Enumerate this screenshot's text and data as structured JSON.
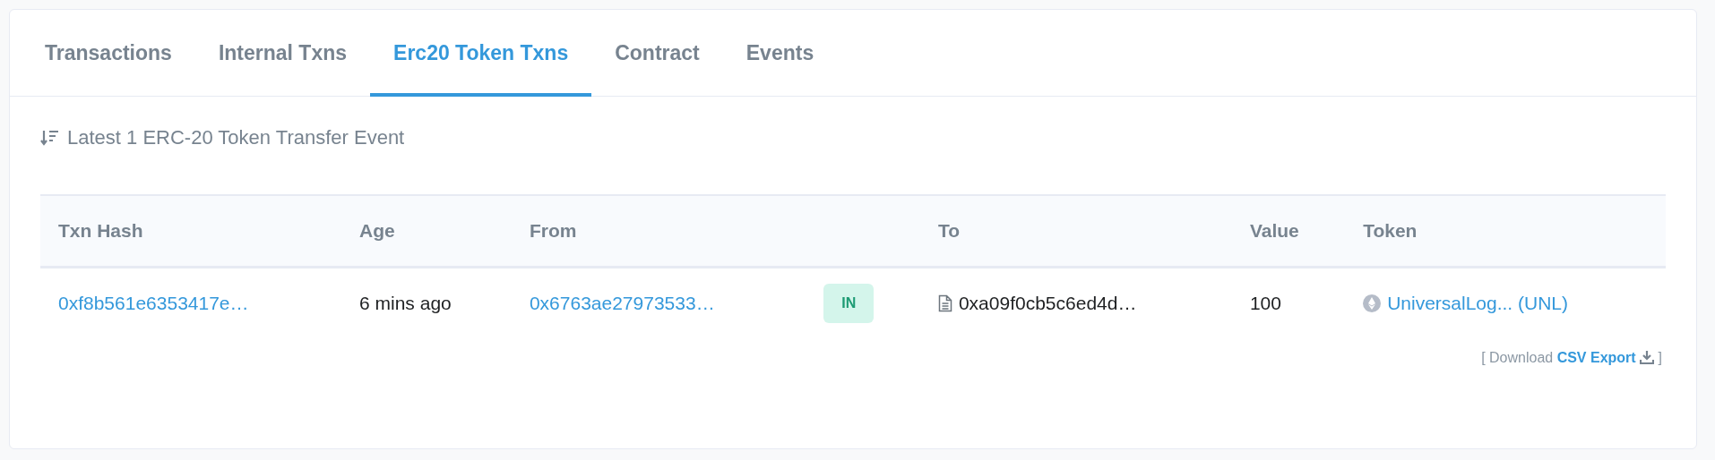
{
  "tabs": [
    {
      "label": "Transactions",
      "selected": false
    },
    {
      "label": "Internal Txns",
      "selected": false
    },
    {
      "label": "Erc20 Token Txns",
      "selected": true
    },
    {
      "label": "Contract",
      "selected": false
    },
    {
      "label": "Events",
      "selected": false
    }
  ],
  "summary": "Latest 1 ERC-20 Token Transfer Event",
  "table": {
    "columns": [
      "Txn Hash",
      "Age",
      "From",
      "",
      "To",
      "Value",
      "Token"
    ],
    "rows": [
      {
        "txn_hash": "0xf8b561e6353417e…",
        "age": "6 mins ago",
        "from": "0x6763ae27973533…",
        "direction": "IN",
        "to": "0xa09f0cb5c6ed4d…",
        "to_is_contract": true,
        "value": "100",
        "token": "UniversalLog... (UNL)"
      }
    ]
  },
  "download": {
    "prefix": "[ Download",
    "link": "CSV Export",
    "suffix": "]"
  }
}
